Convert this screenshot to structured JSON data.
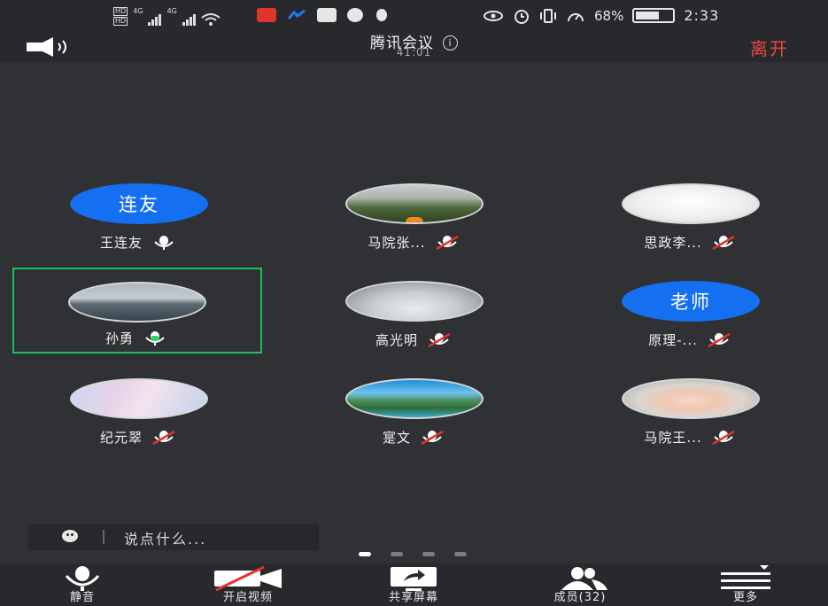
{
  "status_bar": {
    "hd1": "HD",
    "hd2": "HD",
    "net1": "4G",
    "net2": "4G",
    "battery_percent": "68%",
    "time": "2:33"
  },
  "header": {
    "title": "腾讯会议",
    "timer": "41:01",
    "leave_label": "离开"
  },
  "participants": [
    {
      "name": "王连友",
      "avatar_text": "连友",
      "mic": "on"
    },
    {
      "name": "马院张...",
      "avatar_text": "",
      "mic": "muted"
    },
    {
      "name": "思政李...",
      "avatar_text": "",
      "mic": "muted"
    },
    {
      "name": "孙勇",
      "avatar_text": "",
      "mic": "speaking"
    },
    {
      "name": "高光明",
      "avatar_text": "",
      "mic": "muted"
    },
    {
      "name": "原理-...",
      "avatar_text": "老师",
      "mic": "muted"
    },
    {
      "name": "纪元翠",
      "avatar_text": "",
      "mic": "muted"
    },
    {
      "name": "寔文",
      "avatar_text": "",
      "mic": "muted"
    },
    {
      "name": "马院王...",
      "avatar_text": "",
      "mic": "muted"
    }
  ],
  "chat": {
    "placeholder": "说点什么..."
  },
  "pagination": {
    "pages": 4,
    "current": 1
  },
  "toolbar": {
    "mute_label": "静音",
    "video_label": "开启视频",
    "share_label": "共享屏幕",
    "members_label": "成员(32)",
    "more_label": "更多"
  },
  "colors": {
    "accent_blue": "#1470f0",
    "leave_red": "#f0443d",
    "active_border": "#1fbf5a",
    "muted_red": "#e0352b"
  }
}
